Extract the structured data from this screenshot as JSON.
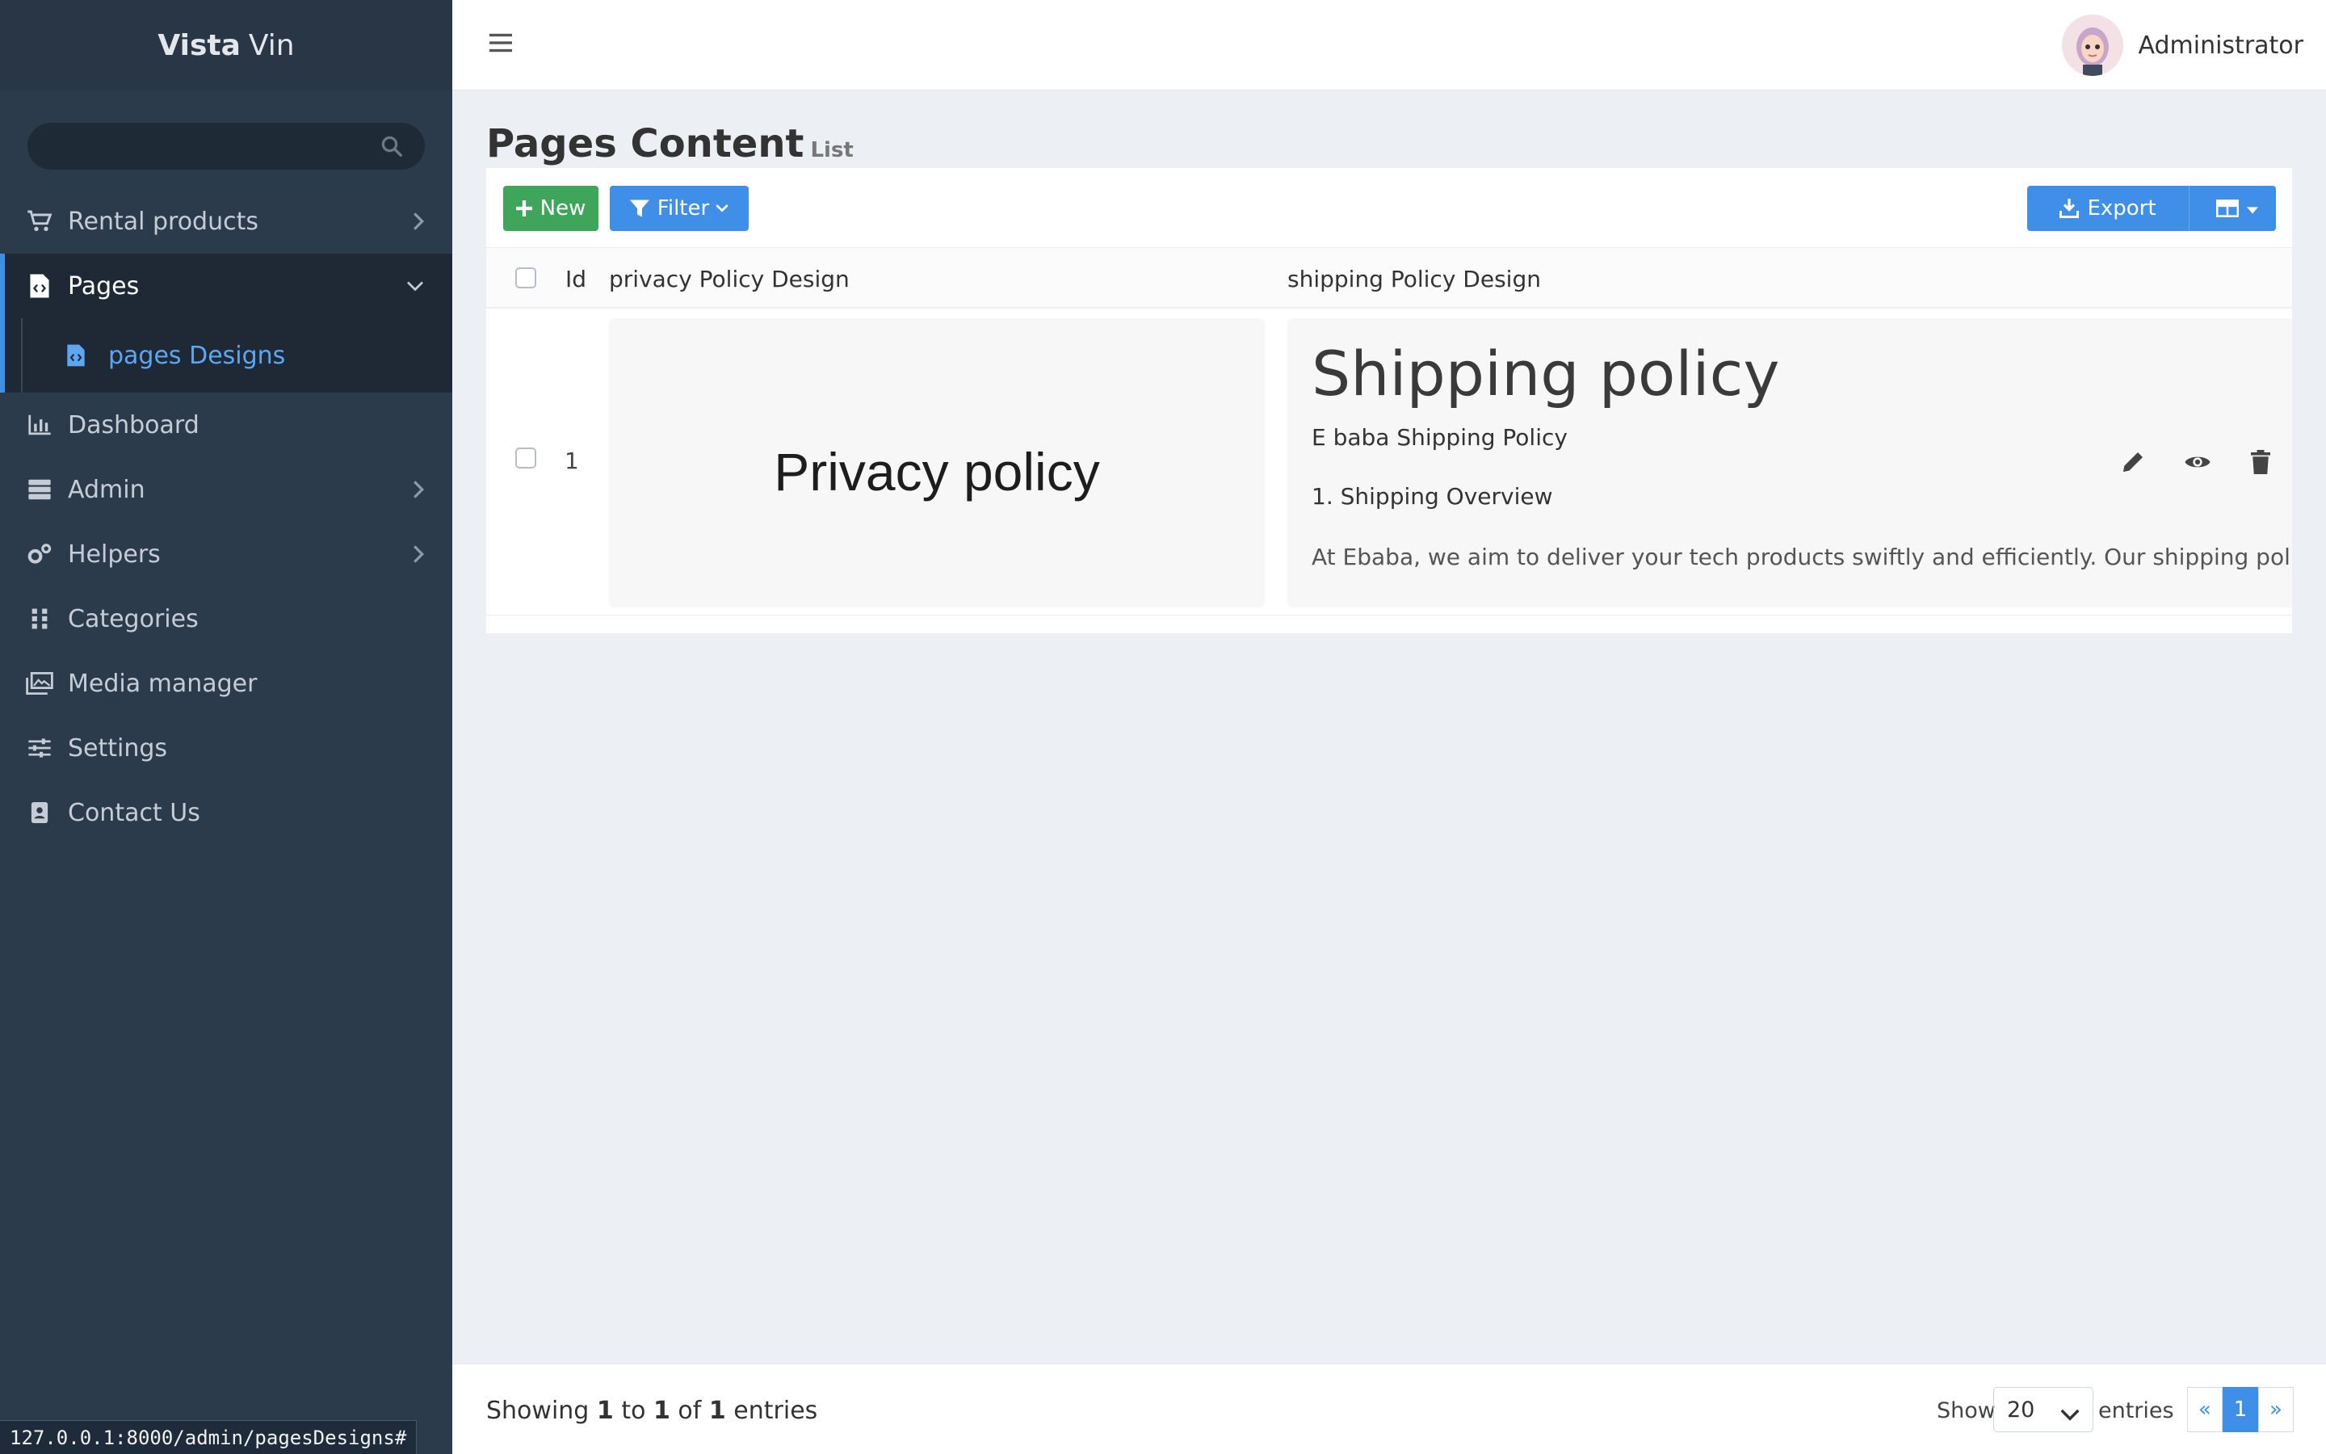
{
  "brand": {
    "bold": "Vista",
    "light": "Vin"
  },
  "search": {
    "placeholder": ""
  },
  "sidebar": {
    "items": [
      {
        "label": "Rental products",
        "icon": "cart-icon",
        "has_children": true
      },
      {
        "label": "Pages",
        "icon": "file-code-icon",
        "active": true,
        "expanded": true
      },
      {
        "label": "Dashboard",
        "icon": "bar-chart-icon"
      },
      {
        "label": "Admin",
        "icon": "server-icon",
        "has_children": true
      },
      {
        "label": "Helpers",
        "icon": "cogs-icon",
        "has_children": true
      },
      {
        "label": "Categories",
        "icon": "grid-icon"
      },
      {
        "label": "Media manager",
        "icon": "images-icon"
      },
      {
        "label": "Settings",
        "icon": "sliders-icon"
      },
      {
        "label": "Contact Us",
        "icon": "address-book-icon"
      }
    ],
    "submenu": {
      "label": "pages Designs",
      "icon": "file-code-icon"
    }
  },
  "topbar": {
    "user_name": "Administrator"
  },
  "page": {
    "title": "Pages Content",
    "subtitle": "List"
  },
  "toolbar": {
    "new_label": "New",
    "filter_label": "Filter",
    "export_label": "Export"
  },
  "table": {
    "columns": [
      "Id",
      "privacy Policy Design",
      "shipping Policy Design"
    ],
    "rows": [
      {
        "id": "1",
        "privacy": "Privacy policy",
        "shipping": {
          "heading": "Shipping policy",
          "sub": "E baba Shipping Policy",
          "section": "1. Shipping Overview",
          "paragraph": "At Ebaba, we aim to deliver your tech products swiftly and efficiently. Our shipping policy outlines"
        }
      }
    ]
  },
  "footer": {
    "showing_prefix": "Showing",
    "from": "1",
    "to_word": "to",
    "to": "1",
    "of_word": "of",
    "total": "1",
    "entries_word": "entries",
    "show_label": "Show",
    "per_page": "20",
    "entries_label": "entries",
    "pager": {
      "prev": "«",
      "current": "1",
      "next": "»"
    }
  },
  "statusbar": {
    "url": "127.0.0.1:8000/admin/pagesDesigns#"
  },
  "colors": {
    "sidebar": "#2c3b4c",
    "accent": "#3f8fe8",
    "success": "#3fa55a"
  }
}
